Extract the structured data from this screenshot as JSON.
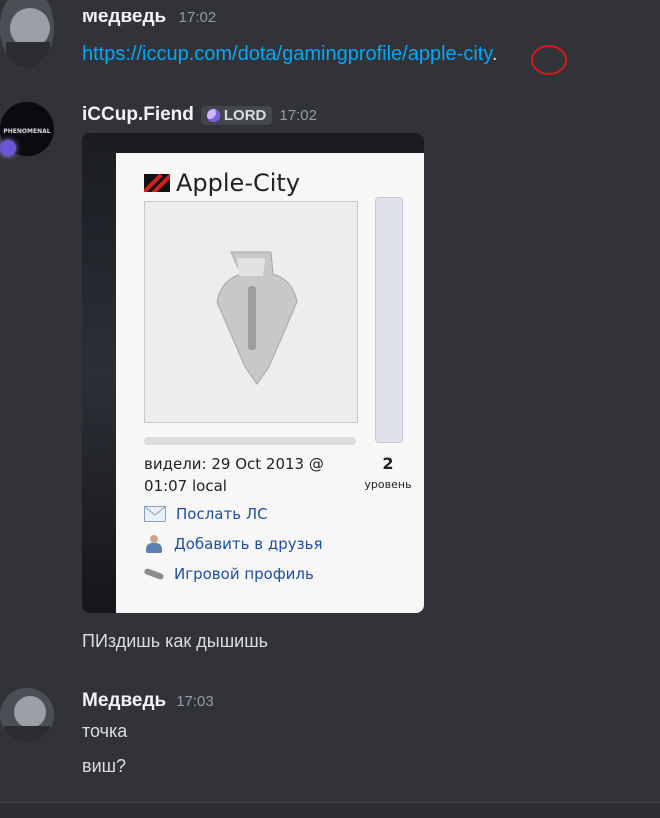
{
  "messages": [
    {
      "username": "Медведь",
      "time": "17:02",
      "link": "https://iccup.com/dota/gamingprofile/apple-city",
      "link_suffix": "."
    },
    {
      "username": "iCCup.Fiend",
      "badge": "LORD",
      "time": "17:02",
      "avatar_text": "PHENOMENAL",
      "embed": {
        "profile_name": "Apple-City",
        "seen_text": "видели: 29 Oct 2013 @ 01:07 local",
        "level_number": "2",
        "level_label": "уровень",
        "actions": [
          {
            "label": "Послать ЛС",
            "icon": "mail-icon"
          },
          {
            "label": "Добавить в друзья",
            "icon": "add-friend-icon"
          },
          {
            "label": "Игровой профиль",
            "icon": "game-profile-icon"
          }
        ]
      },
      "text": "ПИздишь как дышишь"
    },
    {
      "username": "Медведь",
      "time": "17:03",
      "lines": [
        "точка",
        "виш?"
      ]
    }
  ],
  "colors": {
    "background": "#313338",
    "link": "#00a8fc",
    "username": "#f2f3f5",
    "timestamp": "#949ba4",
    "annotation": "#d7191c"
  }
}
